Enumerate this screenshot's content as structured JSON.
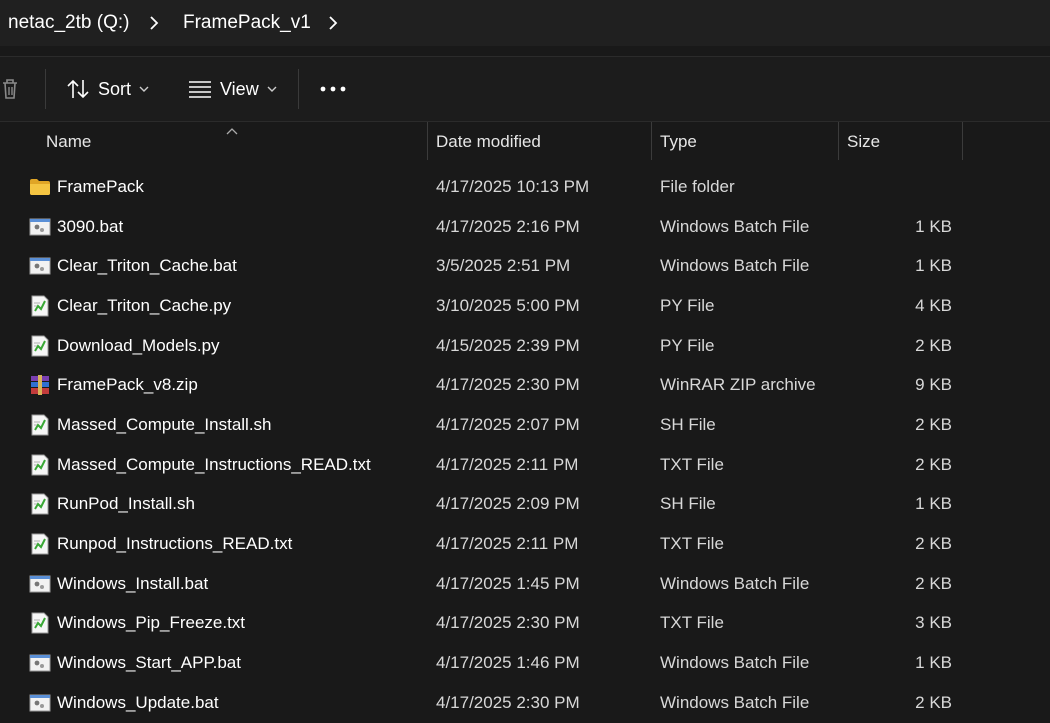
{
  "breadcrumb": {
    "items": [
      "netac_2tb (Q:)",
      "FramePack_v1"
    ]
  },
  "toolbar": {
    "sort_label": "Sort",
    "view_label": "View",
    "more_label": "•••"
  },
  "columns": {
    "name": "Name",
    "date": "Date modified",
    "type": "Type",
    "size": "Size"
  },
  "files": [
    {
      "icon": "folder-icon",
      "name": "FramePack",
      "date": "4/17/2025 10:13 PM",
      "type": "File folder",
      "size": ""
    },
    {
      "icon": "batch-file-icon",
      "name": "3090.bat",
      "date": "4/17/2025 2:16 PM",
      "type": "Windows Batch File",
      "size": "1 KB"
    },
    {
      "icon": "batch-file-icon",
      "name": "Clear_Triton_Cache.bat",
      "date": "3/5/2025 2:51 PM",
      "type": "Windows Batch File",
      "size": "1 KB"
    },
    {
      "icon": "text-file-icon",
      "name": "Clear_Triton_Cache.py",
      "date": "3/10/2025 5:00 PM",
      "type": "PY File",
      "size": "4 KB"
    },
    {
      "icon": "text-file-icon",
      "name": "Download_Models.py",
      "date": "4/15/2025 2:39 PM",
      "type": "PY File",
      "size": "2 KB"
    },
    {
      "icon": "winrar-archive-icon",
      "name": "FramePack_v8.zip",
      "date": "4/17/2025 2:30 PM",
      "type": "WinRAR ZIP archive",
      "size": "9 KB"
    },
    {
      "icon": "text-file-icon",
      "name": "Massed_Compute_Install.sh",
      "date": "4/17/2025 2:07 PM",
      "type": "SH File",
      "size": "2 KB"
    },
    {
      "icon": "text-file-icon",
      "name": "Massed_Compute_Instructions_READ.txt",
      "date": "4/17/2025 2:11 PM",
      "type": "TXT File",
      "size": "2 KB"
    },
    {
      "icon": "text-file-icon",
      "name": "RunPod_Install.sh",
      "date": "4/17/2025 2:09 PM",
      "type": "SH File",
      "size": "1 KB"
    },
    {
      "icon": "text-file-icon",
      "name": "Runpod_Instructions_READ.txt",
      "date": "4/17/2025 2:11 PM",
      "type": "TXT File",
      "size": "2 KB"
    },
    {
      "icon": "batch-file-icon",
      "name": "Windows_Install.bat",
      "date": "4/17/2025 1:45 PM",
      "type": "Windows Batch File",
      "size": "2 KB"
    },
    {
      "icon": "text-file-icon",
      "name": "Windows_Pip_Freeze.txt",
      "date": "4/17/2025 2:30 PM",
      "type": "TXT File",
      "size": "3 KB"
    },
    {
      "icon": "batch-file-icon",
      "name": "Windows_Start_APP.bat",
      "date": "4/17/2025 1:46 PM",
      "type": "Windows Batch File",
      "size": "1 KB"
    },
    {
      "icon": "batch-file-icon",
      "name": "Windows_Update.bat",
      "date": "4/17/2025 2:30 PM",
      "type": "Windows Batch File",
      "size": "2 KB"
    }
  ],
  "colors": {
    "background": "#191919",
    "toolbar": "#1c1c1c",
    "addressbar": "#202020",
    "folder": "#f5c542"
  }
}
